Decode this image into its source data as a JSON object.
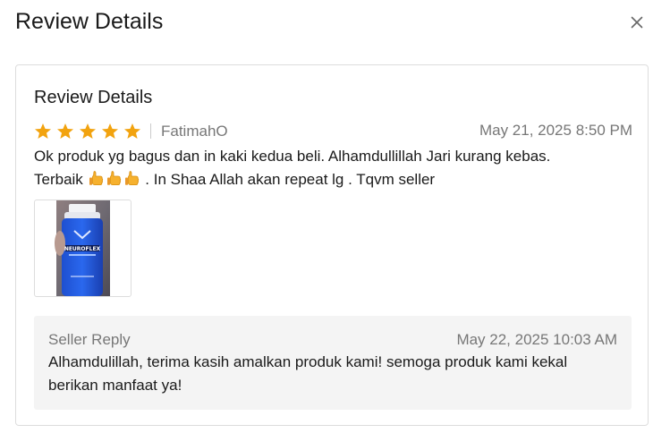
{
  "dialog": {
    "title": "Review Details"
  },
  "review": {
    "section_title": "Review Details",
    "rating": 5,
    "star_color": "#F2A30F",
    "reviewer": "FatimahO",
    "date": "May 21, 2025 8:50 PM",
    "text_line1": "Ok produk yg bagus dan in kaki kedua beli. Alhamdullillah Jari kurang kebas.",
    "text_line2_start": "Terbaik",
    "emoji": "thumbs-up",
    "emoji_count": 3,
    "text_line2_end": ". In Shaa Allah akan repeat lg . Tqvm seller",
    "image_alt": "Product photo",
    "image_label": "NEUROFLEX"
  },
  "seller_reply": {
    "label": "Seller Reply",
    "date": "May 22, 2025 10:03 AM",
    "text": "Alhamdulillah, terima kasih amalkan produk kami! semoga produk kami kekal berikan manfaat ya!"
  }
}
